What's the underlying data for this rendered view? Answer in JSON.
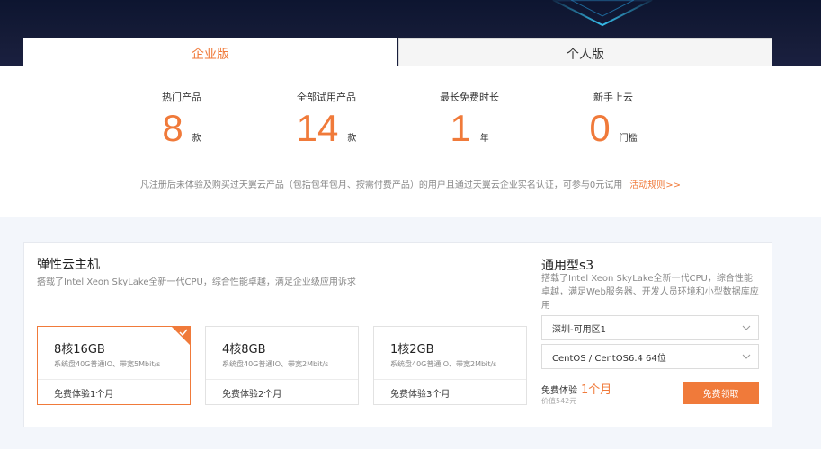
{
  "tabs": [
    {
      "label": "企业版",
      "active": true
    },
    {
      "label": "个人版",
      "active": false
    }
  ],
  "stats": [
    {
      "title": "热门产品",
      "value": "8",
      "unit": "款"
    },
    {
      "title": "全部试用产品",
      "value": "14",
      "unit": "款"
    },
    {
      "title": "最长免费时长",
      "value": "1",
      "unit": "年"
    },
    {
      "title": "新手上云",
      "value": "0",
      "unit": "门槛"
    }
  ],
  "notice": {
    "text": "凡注册后未体验及购买过天翼云产品（包括包年包月、按需付费产品）的用户且通过天翼云企业实名认证，可参与0元试用",
    "link": "活动规则>>"
  },
  "product": {
    "title": "弹性云主机",
    "description": "搭载了Intel Xeon SkyLake全新一代CPU，综合性能卓越，满足企业级应用诉求",
    "plans": [
      {
        "name": "8核16GB",
        "spec": "系统盘40G普通IO、带宽5Mbit/s",
        "trial": "免费体验1个月",
        "selected": true
      },
      {
        "name": "4核8GB",
        "spec": "系统盘40G普通IO、带宽2Mbit/s",
        "trial": "免费体验2个月",
        "selected": false
      },
      {
        "name": "1核2GB",
        "spec": "系统盘40G普通IO、带宽2Mbit/s",
        "trial": "免费体验3个月",
        "selected": false
      }
    ]
  },
  "detail": {
    "title": "通用型s3",
    "description": "搭载了Intel Xeon SkyLake全新一代CPU，综合性能卓越，满足Web服务器、开发人员环境和小型数据库应用",
    "region": "深圳-可用区1",
    "os": "CentOS / CentOS6.4 64位",
    "free_label": "免费体验",
    "free_duration": "1个月",
    "original_price": "价值542元",
    "claim_button": "免费领取"
  },
  "colors": {
    "accent": "#f07a3a",
    "banner": "#0d1530"
  },
  "icons": {
    "dropdown": "chevron-down-icon",
    "selected": "check-icon"
  }
}
